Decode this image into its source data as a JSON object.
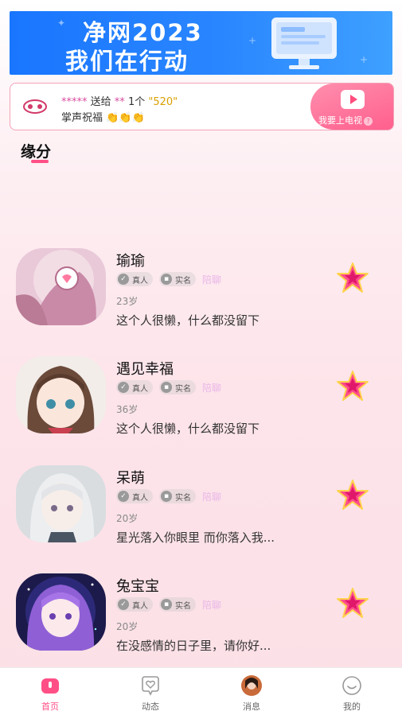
{
  "banner": {
    "line1": "净网2023",
    "line2": "我们在行动"
  },
  "gift_notice": {
    "sender": "*****",
    "action": "送给",
    "receiver": "**",
    "count": "1个",
    "gift_name": "\"520\"",
    "message": "掌声祝福",
    "claps": "👏👏👏",
    "tv_button": "我要上电视",
    "help_icon": "?"
  },
  "section": {
    "title": "缘分"
  },
  "users": [
    {
      "name": "瑜瑜",
      "badge_real_person": "真人",
      "badge_real_name": "实名",
      "badge_chat": "陪聊",
      "age": "23岁",
      "bio": "这个人很懒，什么都没留下"
    },
    {
      "name": "遇见幸福",
      "badge_real_person": "真人",
      "badge_real_name": "实名",
      "badge_chat": "陪聊",
      "age": "36岁",
      "bio": "这个人很懒，什么都没留下"
    },
    {
      "name": "呆萌",
      "badge_real_person": "真人",
      "badge_real_name": "实名",
      "badge_chat": "陪聊",
      "age": "20岁",
      "bio": "星光落入你眼里 而你落入我..."
    },
    {
      "name": "兔宝宝",
      "badge_real_person": "真人",
      "badge_real_name": "实名",
      "badge_chat": "陪聊",
      "age": "20岁",
      "bio": "在没感情的日子里，请你好..."
    }
  ],
  "tabbar": {
    "home": "首页",
    "moments": "动态",
    "messages": "消息",
    "mine": "我的"
  },
  "colors": {
    "accent": "#ff4f86",
    "banner_blue": "#1976ff",
    "chat_badge": "#e9b6e8"
  }
}
